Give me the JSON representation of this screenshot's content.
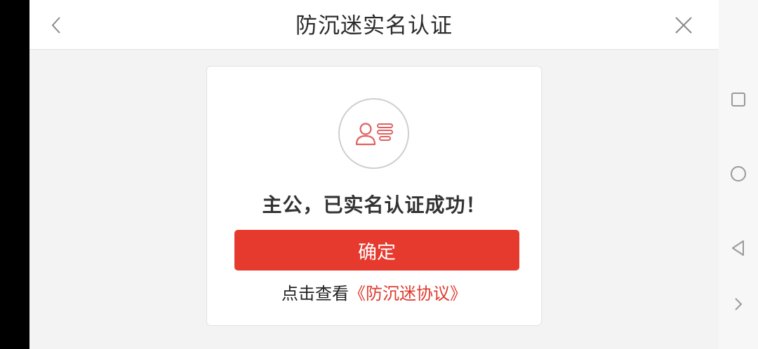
{
  "header": {
    "title": "防沉迷实名认证",
    "back_icon": "chevron-left-icon",
    "close_icon": "close-icon"
  },
  "card": {
    "icon": "id-card-icon",
    "success_message": "主公，已实名认证成功！",
    "confirm_label": "确定",
    "agreement_prefix": "点击查看",
    "agreement_link": "《防沉迷协议》"
  },
  "colors": {
    "accent": "#e63a2e",
    "text": "#333333",
    "background": "#f3f3f3"
  },
  "system_nav": {
    "icons": [
      "recent-apps-icon",
      "home-icon",
      "back-triangle-icon",
      "expand-icon"
    ]
  }
}
